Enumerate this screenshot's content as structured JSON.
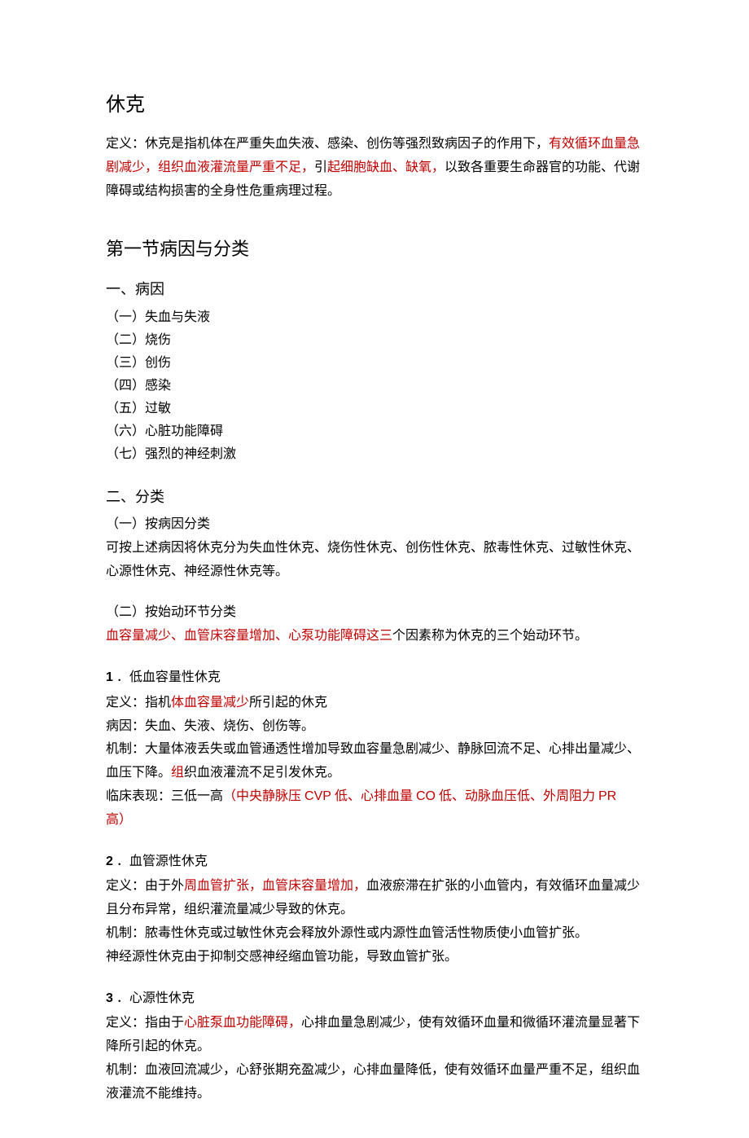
{
  "title": "休克",
  "definition": {
    "label": "定义：",
    "p1": "休克是指机体在严重失血失液、感染、创伤等强烈致病因子的作用下，",
    "red1": "有效循环血量急剧减少，组织血液灌流量严重不足，",
    "p2": "引",
    "red2": "起细胞缺血、缺氧，",
    "p3": "以致各重要生命器官的功能、代谢障碍或结构损害的全身性危重病理过程。"
  },
  "s1": {
    "heading": "第一节病因与分类",
    "causes_heading": "一、病因",
    "causes": [
      "（一）失血与失液",
      "（二）烧伤",
      "（三）创伤",
      "（四）感染",
      "（五）过敏",
      "（六）心脏功能障碍",
      "（七）强烈的神经刺激"
    ],
    "class_heading": "二、分类",
    "by_cause_heading": "（一）按病因分类",
    "by_cause_text": "可按上述病因将休克分为失血性休克、烧伤性休克、创伤性休克、脓毒性休克、过敏性休克、心源性休克、神经源性休克等。",
    "by_init_heading": "（二）按始动环节分类",
    "by_init_red": "血容量减少、血管床容量增加、心泵功能障碍这三",
    "by_init_rest": "个因素称为休克的三个始动环节。"
  },
  "type1": {
    "num": "1",
    "title": " ．低血容量性休克",
    "def_label": "定义：指机",
    "def_red": "体血容量减少",
    "def_rest": "所引起的休克",
    "cause": "病因：失血、失液、烧伤、创伤等。",
    "mech1": "机制：大量体液丢失或血管通透性增加导致血容量急剧减少、静脉回流不足、心排出量减少、血压下降。",
    "mech_red": "组",
    "mech2": "织血液灌流不足引发休克。",
    "clinical_label": "临床表现：三低一高",
    "clinical_red1": "（中央静脉压 ",
    "clinical_cvp": "CVP",
    "clinical_red2": " 低、心排血量 ",
    "clinical_co": "CO",
    "clinical_red3": " 低、动脉血压低、外周阻力 ",
    "clinical_pr": "PR",
    "clinical_red4": " 高）"
  },
  "type2": {
    "num": "2",
    "title": " ．血管源性休克",
    "def_label": "定义：由于外",
    "def_red": "周血管扩张，血管床容量增加，",
    "def_rest": "血液瘀滞在扩张的小血管内，有效循环血量减少且分布异常，组织灌流量减少导致的休克。",
    "mech": "机制：脓毒性休克或过敏性休克会释放外源性或内源性血管活性物质使小血管扩张。",
    "neuro": "神经源性休克由于抑制交感神经缩血管功能，导致血管扩张。"
  },
  "type3": {
    "num": "3",
    "title": " ．心源性休克",
    "def_label": "定义：指由于",
    "def_red": "心脏泵血功能障碍，",
    "def_rest": "心排血量急剧减少，使有效循环血量和微循环灌流量显著下降所引起的休克。",
    "mech": "机制：血液回流减少，心舒张期充盈减少，心排血量降低，使有效循环血量严重不足，组织血液灌流不能维持。"
  }
}
